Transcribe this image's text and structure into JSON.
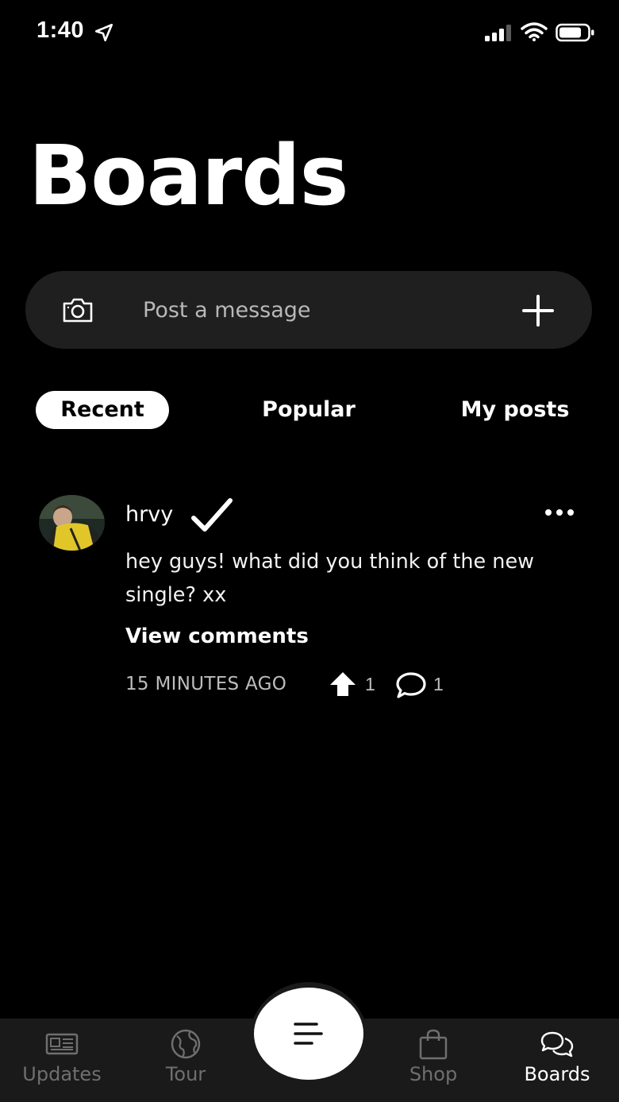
{
  "status_bar": {
    "time": "1:40"
  },
  "page": {
    "title": "Boards"
  },
  "composer": {
    "placeholder": "Post a message"
  },
  "tabs": [
    {
      "label": "Recent",
      "active": true
    },
    {
      "label": "Popular",
      "active": false
    },
    {
      "label": "My posts",
      "active": false
    }
  ],
  "post": {
    "author": "hrvy",
    "body": "hey guys! what did you think of the new single? xx",
    "view_comments_label": "View comments",
    "timestamp": "15 MINUTES AGO",
    "upvotes": "1",
    "comments": "1"
  },
  "tab_bar": {
    "items": [
      {
        "label": "Updates",
        "icon": "newspaper-icon",
        "active": false
      },
      {
        "label": "Tour",
        "icon": "globe-icon",
        "active": false
      },
      {
        "label": "Shop",
        "icon": "shopping-bag-icon",
        "active": false
      },
      {
        "label": "Boards",
        "icon": "chat-bubbles-icon",
        "active": true
      }
    ],
    "center_icon": "menu-icon"
  },
  "colors": {
    "background": "#000000",
    "composer_bg": "#1f1f1f",
    "tab_bar_bg": "#1a1a1a",
    "muted_text": "#bdbdbd",
    "inactive_nav": "#6f6f6f"
  }
}
